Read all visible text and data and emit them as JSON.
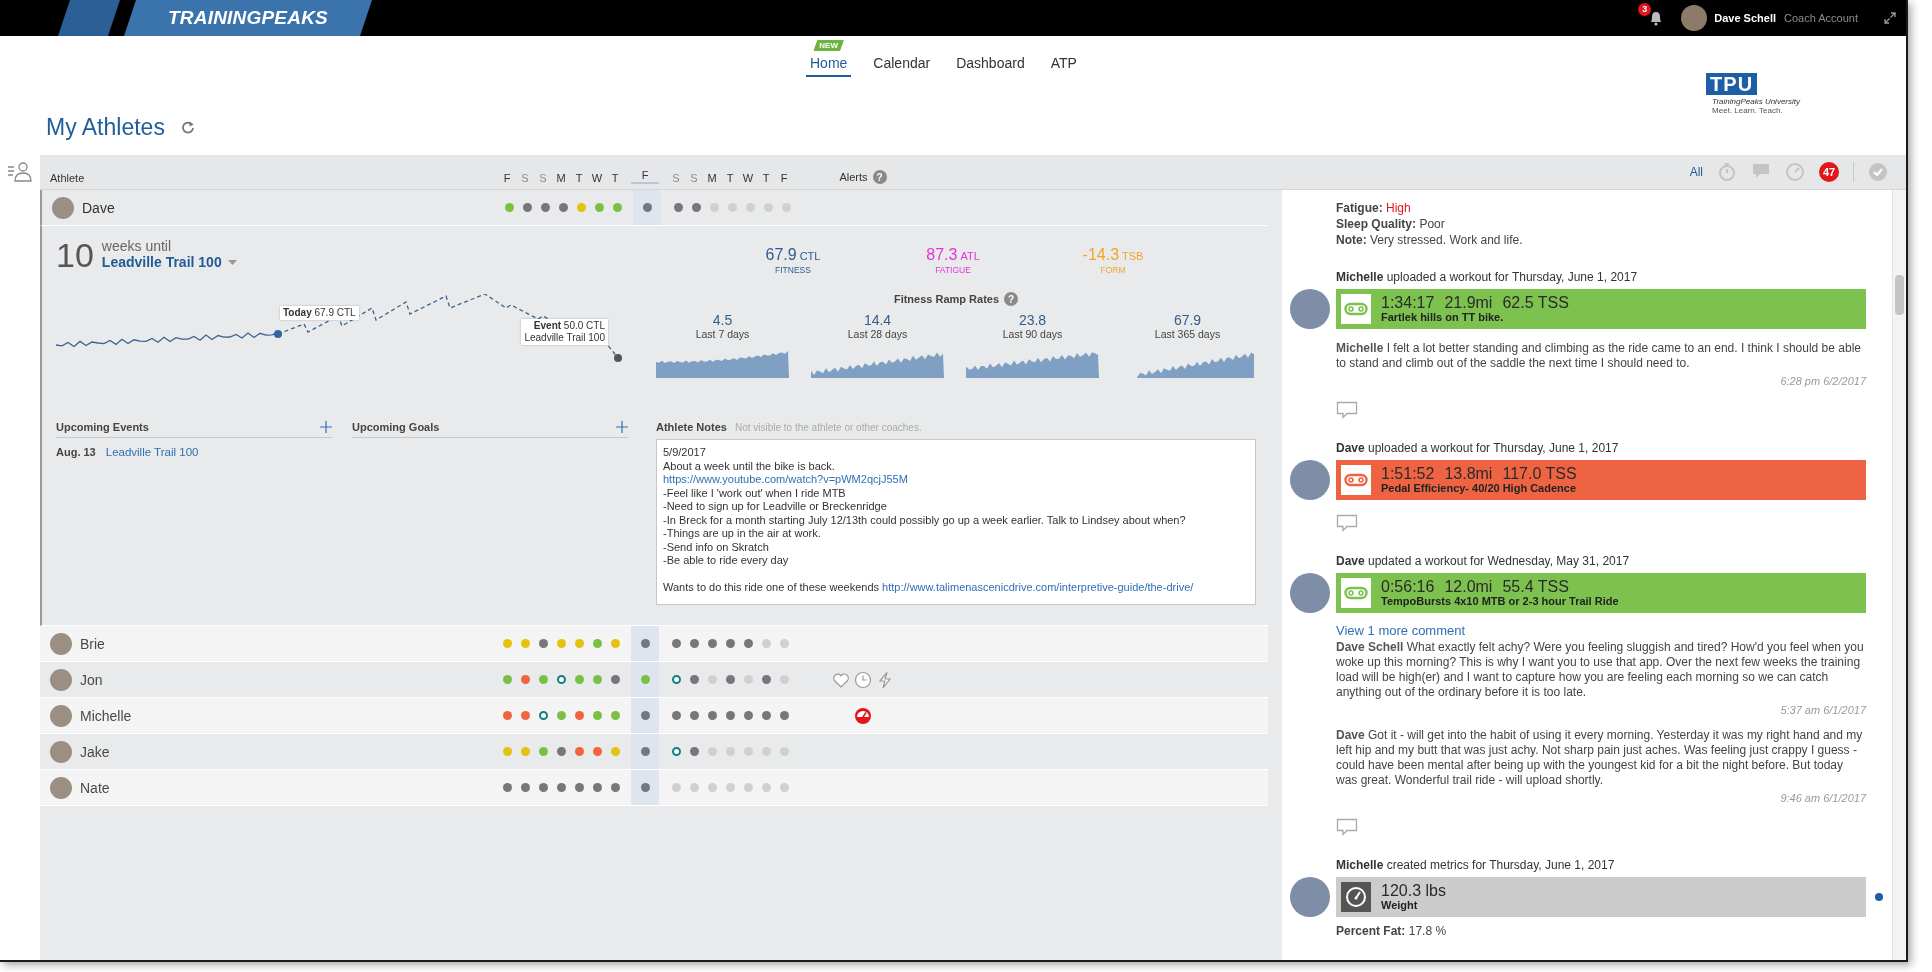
{
  "top_bar": {
    "logo": "TRAININGPEAKS",
    "notification_count": "3",
    "user_name": "Dave Schell",
    "account_type": "Coach Account"
  },
  "nav": {
    "tabs": [
      {
        "label": "Home",
        "selected": true,
        "badge": "NEW"
      },
      {
        "label": "Calendar",
        "selected": false
      },
      {
        "label": "Dashboard",
        "selected": false
      },
      {
        "label": "ATP",
        "selected": false
      }
    ]
  },
  "university_logo": {
    "mark": "TPU",
    "name": "TrainingPeaks University",
    "tagline": "Meet. Learn. Teach."
  },
  "page_title": "My Athletes",
  "athlete_list": {
    "athlete": "Athlete",
    "alerts": "Alerts",
    "alerts_help": "?",
    "days_before": [
      {
        "label": "F",
        "weekend": false
      },
      {
        "label": "S",
        "weekend": true
      },
      {
        "label": "S",
        "weekend": true
      },
      {
        "label": "M",
        "weekend": false
      },
      {
        "label": "T",
        "weekend": false
      },
      {
        "label": "W",
        "weekend": false
      },
      {
        "label": "T",
        "weekend": false
      }
    ],
    "today": {
      "label": "F"
    },
    "days_after": [
      {
        "label": "S",
        "weekend": true
      },
      {
        "label": "S",
        "weekend": true
      },
      {
        "label": "M",
        "weekend": false
      },
      {
        "label": "T",
        "weekend": false
      },
      {
        "label": "W",
        "weekend": false
      },
      {
        "label": "T",
        "weekend": false
      },
      {
        "label": "F",
        "weekend": false
      }
    ]
  },
  "athletes": [
    {
      "name": "Dave",
      "expanded": true,
      "week_before": [
        {
          "kind": "dot",
          "color": "#7ac143"
        },
        {
          "kind": "dot",
          "color": "#77777b"
        },
        {
          "kind": "dot",
          "color": "#77777b"
        },
        {
          "kind": "dot",
          "color": "#77777b"
        },
        {
          "kind": "dot",
          "color": "#e6c10f"
        },
        {
          "kind": "dot",
          "color": "#7ac143"
        },
        {
          "kind": "dot",
          "color": "#7ac143"
        }
      ],
      "today": {
        "kind": "dot",
        "color": "#77777b"
      },
      "week_after": [
        {
          "kind": "dot",
          "color": "#77777b"
        },
        {
          "kind": "dot",
          "color": "#77777b"
        },
        {
          "kind": "dot",
          "color": "#d0d0d0"
        },
        {
          "kind": "dot",
          "color": "#d0d0d0"
        },
        {
          "kind": "dot",
          "color": "#d0d0d0"
        },
        {
          "kind": "dot",
          "color": "#d0d0d0"
        },
        {
          "kind": "dot",
          "color": "#d0d0d0"
        }
      ],
      "detail": {
        "countdown": {
          "number": "10",
          "unit": "weeks until",
          "event": "Leadville Trail 100"
        },
        "metrics": [
          {
            "value": "67.9",
            "unit": "CTL",
            "label": "FITNESS",
            "color": "#2f5d8e"
          },
          {
            "value": "87.3",
            "unit": "ATL",
            "label": "FATIGUE",
            "color": "#e534d6"
          },
          {
            "value": "-14.3",
            "unit": "TSB",
            "label": "FORM",
            "color": "#f5a428"
          }
        ],
        "ramp_rates": {
          "title": "Fitness Ramp Rates",
          "help": "?",
          "items": [
            {
              "value": "4.5",
              "label": "Last 7 days"
            },
            {
              "value": "14.4",
              "label": "Last 28 days"
            },
            {
              "value": "23.8",
              "label": "Last 90 days"
            },
            {
              "value": "67.9",
              "label": "Last 365 days"
            }
          ]
        },
        "fitness_chart": {
          "today_label": "Today",
          "today_value": "67.9 CTL",
          "event_label": "Event",
          "event_value": "50.0 CTL",
          "event_name": "Leadville Trail 100"
        },
        "upcoming_events": {
          "title": "Upcoming Events",
          "items": [
            {
              "date": "Aug. 13",
              "name": "Leadville Trail 100"
            }
          ]
        },
        "upcoming_goals": {
          "title": "Upcoming Goals"
        },
        "notes": {
          "title": "Athlete Notes",
          "hint": "Not visible to the athlete or other coaches.",
          "paragraphs": [
            [
              {
                "text": "5/9/2017"
              },
              {
                "text": "About a week until the bike is back."
              },
              {
                "link": "https://www.youtube.com/watch?v=pWM2qcjJ55M"
              },
              {
                "text": "-Feel like I 'work out' when I ride MTB"
              },
              {
                "text": "-Need to sign up for Leadville or Breckenridge"
              },
              {
                "text": "-In Breck for a month starting July 12/13th could possibly go up a week earlier. Talk to Lindsey about when?"
              },
              {
                "text": "-Things are up in the air at work."
              },
              {
                "text": "-Send info on Skratch"
              },
              {
                "text": "-Be able to ride every day"
              }
            ],
            [
              {
                "text": "Wants to do this ride one of these weekends",
                "link": "http://www.talimenascenicdrive.com/interpretive-guide/the-drive/"
              }
            ]
          ]
        }
      }
    },
    {
      "name": "Brie",
      "expanded": false,
      "week_before": [
        {
          "kind": "dot",
          "color": "#e6c10f"
        },
        {
          "kind": "dot",
          "color": "#e6c10f"
        },
        {
          "kind": "dot",
          "color": "#77777b"
        },
        {
          "kind": "dot",
          "color": "#e6c10f"
        },
        {
          "kind": "dot",
          "color": "#e6c10f"
        },
        {
          "kind": "dot",
          "color": "#7ac143"
        },
        {
          "kind": "dot",
          "color": "#e6c10f"
        }
      ],
      "today": {
        "kind": "dot",
        "color": "#77777b"
      },
      "week_after": [
        {
          "kind": "dot",
          "color": "#77777b"
        },
        {
          "kind": "dot",
          "color": "#77777b"
        },
        {
          "kind": "dot",
          "color": "#77777b"
        },
        {
          "kind": "dot",
          "color": "#77777b"
        },
        {
          "kind": "dot",
          "color": "#77777b"
        },
        {
          "kind": "dot",
          "color": "#d0d0d0"
        },
        {
          "kind": "dot",
          "color": "#d0d0d0"
        }
      ]
    },
    {
      "name": "Jon",
      "expanded": false,
      "week_before": [
        {
          "kind": "dot",
          "color": "#7ac143"
        },
        {
          "kind": "dot",
          "color": "#f0643f"
        },
        {
          "kind": "dot",
          "color": "#7ac143"
        },
        {
          "kind": "ring",
          "color": "#137f80"
        },
        {
          "kind": "dot",
          "color": "#7ac143"
        },
        {
          "kind": "dot",
          "color": "#7ac143"
        },
        {
          "kind": "dot",
          "color": "#77777b"
        }
      ],
      "today": {
        "kind": "dot",
        "color": "#7ac143"
      },
      "week_after": [
        {
          "kind": "ring",
          "color": "#137f80"
        },
        {
          "kind": "dot",
          "color": "#77777b"
        },
        {
          "kind": "dot",
          "color": "#d0d0d0"
        },
        {
          "kind": "dot",
          "color": "#77777b"
        },
        {
          "kind": "dot",
          "color": "#d0d0d0"
        },
        {
          "kind": "dot",
          "color": "#77777b"
        },
        {
          "kind": "dot",
          "color": "#d0d0d0"
        }
      ],
      "alerts": [
        {
          "kind": "heart"
        },
        {
          "kind": "clock"
        },
        {
          "kind": "lightning"
        }
      ]
    },
    {
      "name": "Michelle",
      "expanded": false,
      "week_before": [
        {
          "kind": "dot",
          "color": "#f0643f"
        },
        {
          "kind": "dot",
          "color": "#f0643f"
        },
        {
          "kind": "ring",
          "color": "#137f80"
        },
        {
          "kind": "dot",
          "color": "#7ac143"
        },
        {
          "kind": "dot",
          "color": "#f0643f"
        },
        {
          "kind": "dot",
          "color": "#7ac143"
        },
        {
          "kind": "dot",
          "color": "#7ac143"
        }
      ],
      "today": {
        "kind": "dot",
        "color": "#77777b"
      },
      "week_after": [
        {
          "kind": "dot",
          "color": "#77777b"
        },
        {
          "kind": "dot",
          "color": "#77777b"
        },
        {
          "kind": "dot",
          "color": "#77777b"
        },
        {
          "kind": "dot",
          "color": "#77777b"
        },
        {
          "kind": "dot",
          "color": "#77777b"
        },
        {
          "kind": "dot",
          "color": "#77777b"
        },
        {
          "kind": "dot",
          "color": "#77777b"
        }
      ],
      "alerts": [
        {
          "kind": "gauge"
        }
      ]
    },
    {
      "name": "Jake",
      "expanded": false,
      "week_before": [
        {
          "kind": "dot",
          "color": "#e6c10f"
        },
        {
          "kind": "dot",
          "color": "#e6c10f"
        },
        {
          "kind": "dot",
          "color": "#7ac143"
        },
        {
          "kind": "dot",
          "color": "#77777b"
        },
        {
          "kind": "dot",
          "color": "#f0643f"
        },
        {
          "kind": "dot",
          "color": "#f0643f"
        },
        {
          "kind": "dot",
          "color": "#e6c10f"
        }
      ],
      "today": {
        "kind": "dot",
        "color": "#77777b"
      },
      "week_after": [
        {
          "kind": "ring",
          "color": "#137f80"
        },
        {
          "kind": "dot",
          "color": "#77777b"
        },
        {
          "kind": "dot",
          "color": "#d0d0d0"
        },
        {
          "kind": "dot",
          "color": "#d0d0d0"
        },
        {
          "kind": "dot",
          "color": "#d0d0d0"
        },
        {
          "kind": "dot",
          "color": "#d0d0d0"
        },
        {
          "kind": "dot",
          "color": "#d0d0d0"
        }
      ]
    },
    {
      "name": "Nate",
      "expanded": false,
      "week_before": [
        {
          "kind": "dot",
          "color": "#77777b"
        },
        {
          "kind": "dot",
          "color": "#77777b"
        },
        {
          "kind": "dot",
          "color": "#77777b"
        },
        {
          "kind": "dot",
          "color": "#77777b"
        },
        {
          "kind": "dot",
          "color": "#77777b"
        },
        {
          "kind": "dot",
          "color": "#77777b"
        },
        {
          "kind": "dot",
          "color": "#77777b"
        }
      ],
      "today": {
        "kind": "dot",
        "color": "#77777b"
      },
      "week_after": [
        {
          "kind": "dot",
          "color": "#d0d0d0"
        },
        {
          "kind": "dot",
          "color": "#d0d0d0"
        },
        {
          "kind": "dot",
          "color": "#d0d0d0"
        },
        {
          "kind": "dot",
          "color": "#d0d0d0"
        },
        {
          "kind": "dot",
          "color": "#d0d0d0"
        },
        {
          "kind": "dot",
          "color": "#d0d0d0"
        },
        {
          "kind": "dot",
          "color": "#d0d0d0"
        }
      ]
    }
  ],
  "feed_filters": [
    {
      "kind": "all",
      "label": "All",
      "selected": true
    },
    {
      "kind": "stopwatch",
      "selected": false
    },
    {
      "kind": "comment",
      "selected": false
    },
    {
      "kind": "gauge",
      "selected": false
    },
    {
      "kind": "alerts",
      "count": "47",
      "selected": false
    },
    {
      "kind": "check",
      "selected": false
    }
  ],
  "feed": [
    {
      "kind": "metric_details",
      "lines": [
        {
          "label": "Fatigue:",
          "value": "High",
          "alert": true
        },
        {
          "label": "Sleep Quality:",
          "value": "Poor",
          "alert": false
        },
        {
          "label": "Note:",
          "value": "Very stressed. Work and life.",
          "alert": false
        }
      ]
    },
    {
      "kind": "workout",
      "headline": "**Michelle** uploaded a workout for Thursday, June 1, 2017",
      "color": "#7dc24e",
      "duration": "1:34:17",
      "distance": "21.9mi",
      "tss": "62.5 TSS",
      "title": "Fartlek hills on TT bike.",
      "comments": [
        {
          "text": "**Michelle** I felt a lot better standing and climbing as the ride came to an end. I think I should be able to stand and climb out of the saddle the next time I should need to.",
          "time": "6:28 pm 6/2/2017"
        }
      ]
    },
    {
      "kind": "workout",
      "headline": "**Dave** uploaded a workout for Thursday, June 1, 2017",
      "color": "#ee6443",
      "duration": "1:51:52",
      "distance": "13.8mi",
      "tss": "117.0 TSS",
      "title": "Pedal Efficiency- 40/20 High Cadence"
    },
    {
      "kind": "workout",
      "headline": "**Dave** updated a workout for Wednesday, May 31, 2017",
      "color": "#7dc24e",
      "duration": "0:56:16",
      "distance": "12.0mi",
      "tss": "55.4 TSS",
      "title": "TempoBursts 4x10 MTB or 2-3 hour Trail Ride",
      "more_comments": "View 1 more comment",
      "comments": [
        {
          "text": "**Dave Schell** What exactly felt achy? Were you feeling sluggish and tired? How'd you feel when you woke up this morning? This is why I want you to use that app. Over the next few weeks the training load will be high(er) and I want to capture how you are feeling each morning so we can catch anything out of the ordinary before it is too late.",
          "time": "5:37 am 6/1/2017"
        },
        {
          "text": "**Dave** Got it - will get into the habit of using it every morning. Yesterday it was my right hand and my left hip and my butt that was just achy. Not sharp pain just aches. Was feeling just crappy I guess - could have been mental after being up with the youngest kid for a bit the night before. But today was great. Wonderful trail ride - will upload shortly.",
          "time": "9:46 am 6/1/2017"
        }
      ]
    },
    {
      "kind": "metric",
      "headline": "**Michelle** created metrics for Thursday, June 1, 2017",
      "color": "#cccccc",
      "value": "120.3 lbs",
      "title": "Weight",
      "unread": true,
      "details": [
        {
          "label": "Percent Fat:",
          "value": "17.8 %",
          "alert": false
        }
      ]
    }
  ]
}
